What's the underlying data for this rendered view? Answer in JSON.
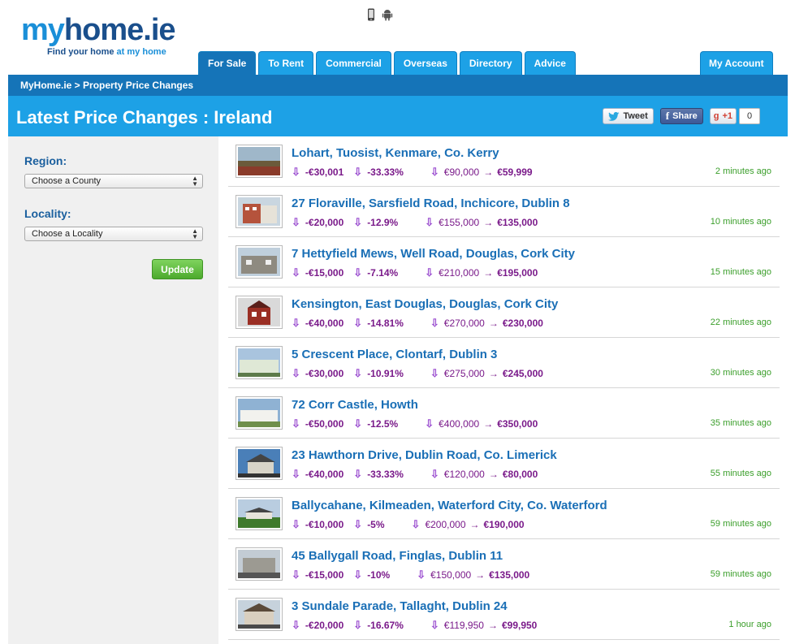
{
  "header": {
    "logo_my": "my",
    "logo_home": "home",
    "logo_ie": ".ie",
    "logo_tag_pre": "Find your home",
    "logo_tag_post": " at my home",
    "device_icons": [
      "mobile-phone-icon",
      "android-icon"
    ]
  },
  "nav": {
    "tabs": [
      {
        "label": "For Sale",
        "active": true
      },
      {
        "label": "To Rent",
        "active": false
      },
      {
        "label": "Commercial",
        "active": false
      },
      {
        "label": "Overseas",
        "active": false
      },
      {
        "label": "Directory",
        "active": false
      },
      {
        "label": "Advice",
        "active": false
      }
    ],
    "account": "My Account"
  },
  "breadcrumb": "MyHome.ie > Property Price Changes",
  "title": "Latest Price Changes : Ireland",
  "social": {
    "tweet": "Tweet",
    "share": "Share",
    "gplus": "+1",
    "gplus_count": "0"
  },
  "filters": {
    "region_label": "Region:",
    "region_value": "Choose a County",
    "locality_label": "Locality:",
    "locality_value": "Choose a Locality",
    "update": "Update"
  },
  "colors": {
    "brand_blue": "#1da1e6",
    "dark_blue": "#1574b8",
    "link_blue": "#1a6fb6",
    "drop_purple": "#7a1a8a",
    "time_green": "#3a9e2a"
  },
  "listings": [
    {
      "address": "Lohart, Tuosist, Kenmare, Co. Kerry",
      "change": "-€30,001",
      "percent": "-33.33%",
      "old_price": "€90,000",
      "new_price": "€59,999",
      "time": "2 minutes ago"
    },
    {
      "address": "27 Floraville, Sarsfield Road, Inchicore, Dublin 8",
      "change": "-€20,000",
      "percent": "-12.9%",
      "old_price": "€155,000",
      "new_price": "€135,000",
      "time": "10 minutes ago"
    },
    {
      "address": "7 Hettyfield Mews, Well Road, Douglas, Cork City",
      "change": "-€15,000",
      "percent": "-7.14%",
      "old_price": "€210,000",
      "new_price": "€195,000",
      "time": "15 minutes ago"
    },
    {
      "address": "Kensington, East Douglas, Douglas, Cork City",
      "change": "-€40,000",
      "percent": "-14.81%",
      "old_price": "€270,000",
      "new_price": "€230,000",
      "time": "22 minutes ago"
    },
    {
      "address": "5 Crescent Place, Clontarf, Dublin 3",
      "change": "-€30,000",
      "percent": "-10.91%",
      "old_price": "€275,000",
      "new_price": "€245,000",
      "time": "30 minutes ago"
    },
    {
      "address": "72 Corr Castle, Howth",
      "change": "-€50,000",
      "percent": "-12.5%",
      "old_price": "€400,000",
      "new_price": "€350,000",
      "time": "35 minutes ago"
    },
    {
      "address": "23 Hawthorn Drive, Dublin Road, Co. Limerick",
      "change": "-€40,000",
      "percent": "-33.33%",
      "old_price": "€120,000",
      "new_price": "€80,000",
      "time": "55 minutes ago"
    },
    {
      "address": "Ballycahane, Kilmeaden, Waterford City, Co. Waterford",
      "change": "-€10,000",
      "percent": "-5%",
      "old_price": "€200,000",
      "new_price": "€190,000",
      "time": "59 minutes ago"
    },
    {
      "address": "45 Ballygall Road, Finglas, Dublin 11",
      "change": "-€15,000",
      "percent": "-10%",
      "old_price": "€150,000",
      "new_price": "€135,000",
      "time": "59 minutes ago"
    },
    {
      "address": "3 Sundale Parade, Tallaght, Dublin 24",
      "change": "-€20,000",
      "percent": "-16.67%",
      "old_price": "€119,950",
      "new_price": "€99,950",
      "time": "1 hour ago"
    }
  ]
}
